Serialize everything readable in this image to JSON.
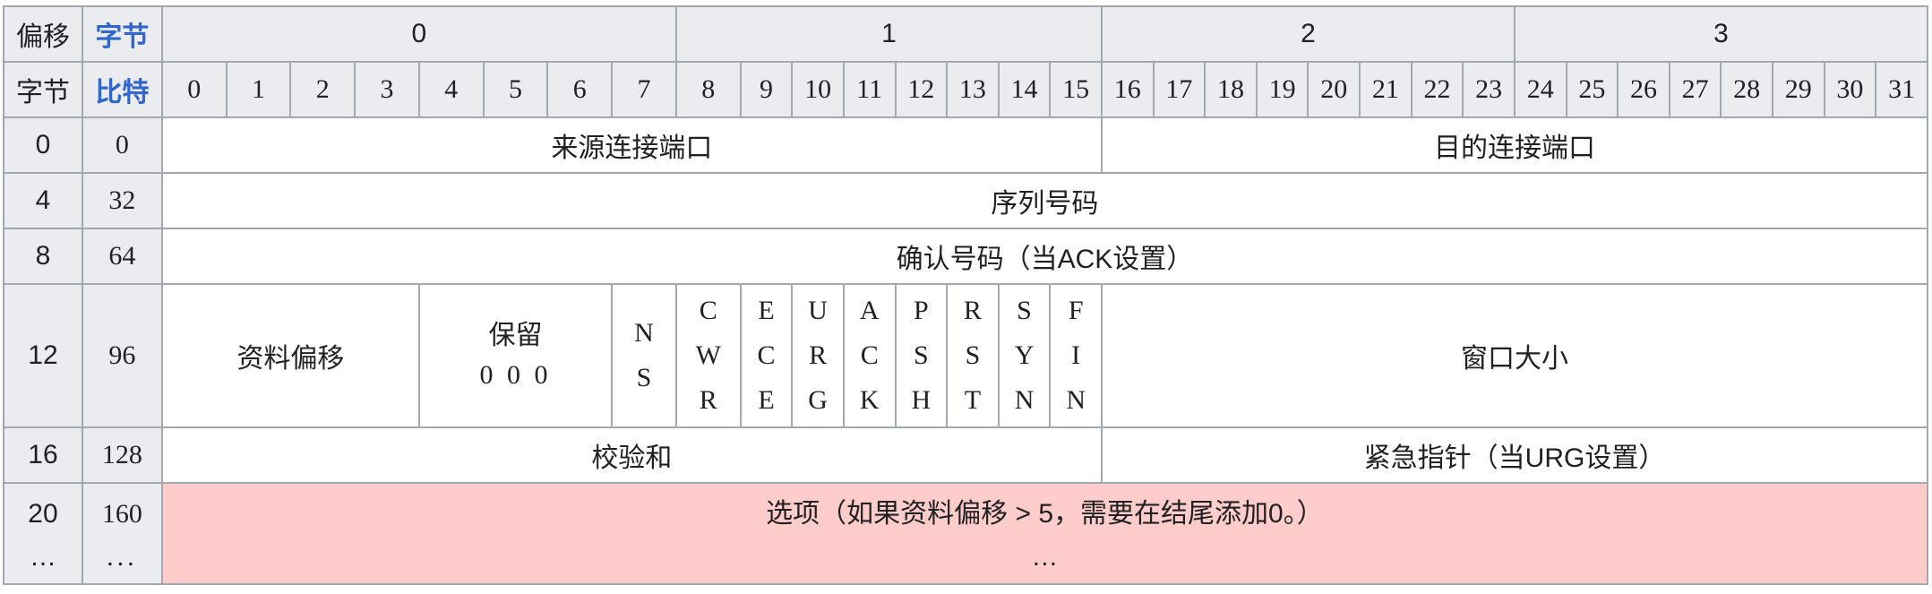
{
  "header": {
    "offset_label": "偏移",
    "byte_label": "字节",
    "byte_label2": "字节",
    "bit_label": "比特",
    "octets": [
      "0",
      "1",
      "2",
      "3"
    ],
    "bits": [
      "0",
      "1",
      "2",
      "3",
      "4",
      "5",
      "6",
      "7",
      "8",
      "9",
      "10",
      "11",
      "12",
      "13",
      "14",
      "15",
      "16",
      "17",
      "18",
      "19",
      "20",
      "21",
      "22",
      "23",
      "24",
      "25",
      "26",
      "27",
      "28",
      "29",
      "30",
      "31"
    ]
  },
  "rows": [
    {
      "byte": "0",
      "bit": "0"
    },
    {
      "byte": "4",
      "bit": "32"
    },
    {
      "byte": "8",
      "bit": "64"
    },
    {
      "byte": "12",
      "bit": "96"
    },
    {
      "byte": "16",
      "bit": "128"
    },
    {
      "byte": "20",
      "byte2": "…",
      "bit": "160",
      "bit2": "..."
    }
  ],
  "fields": {
    "source_port": "来源连接端口",
    "dest_port": "目的连接端口",
    "sequence": "序列号码",
    "ack": "确认号码（当ACK设置）",
    "data_offset": "资料偏移",
    "reserved": "保留",
    "reserved_bits": "0 0 0",
    "ns": [
      "N",
      "S"
    ],
    "cwr": [
      "C",
      "W",
      "R"
    ],
    "ece": [
      "E",
      "C",
      "E"
    ],
    "urg": [
      "U",
      "R",
      "G"
    ],
    "ackf": [
      "A",
      "C",
      "K"
    ],
    "psh": [
      "P",
      "S",
      "H"
    ],
    "rst": [
      "R",
      "S",
      "T"
    ],
    "syn": [
      "S",
      "Y",
      "N"
    ],
    "fin": [
      "F",
      "I",
      "N"
    ],
    "window": "窗口大小",
    "checksum": "校验和",
    "urgent": "紧急指针（当URG设置）",
    "options": "选项（如果资料偏移 > 5，需要在结尾添加0。）",
    "options_more": "…"
  }
}
